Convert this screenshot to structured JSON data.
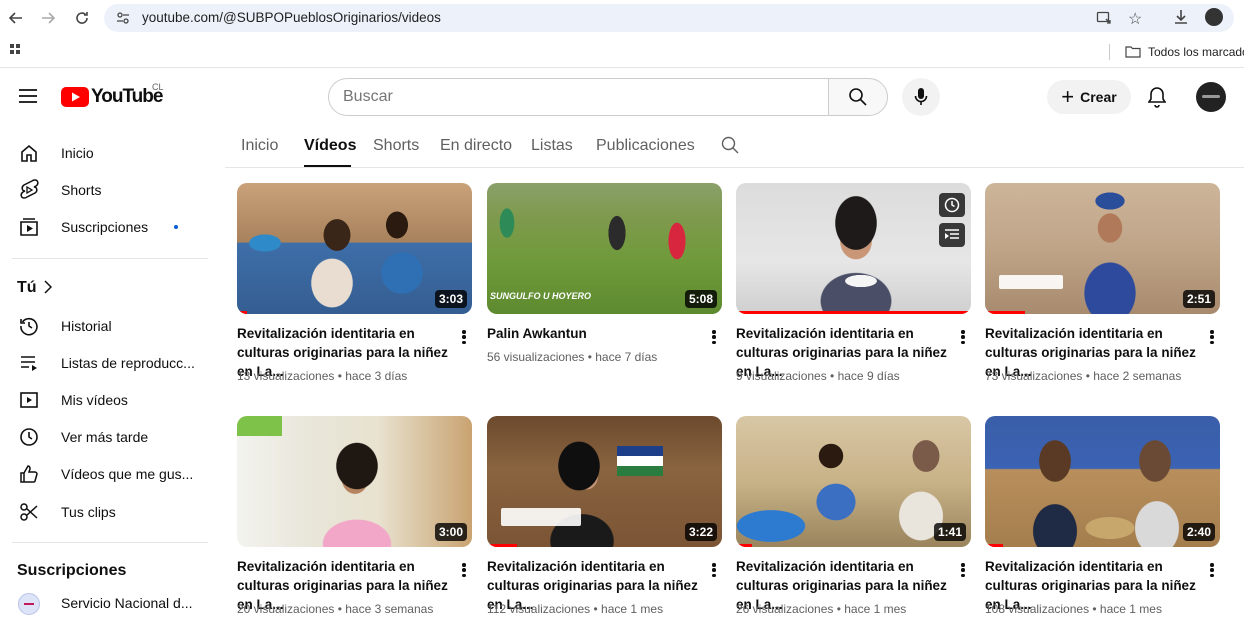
{
  "browser": {
    "url": "youtube.com/@SUBPOPueblosOriginarios/videos",
    "bookmarks_label": "Todos los marcadores"
  },
  "header": {
    "logo_text": "YouTube",
    "region": "CL",
    "search_placeholder": "Buscar",
    "create_label": "Crear"
  },
  "sidebar": {
    "main": [
      {
        "label": "Inicio",
        "icon": "home-icon"
      },
      {
        "label": "Shorts",
        "icon": "shorts-icon"
      },
      {
        "label": "Suscripciones",
        "icon": "subscriptions-icon"
      }
    ],
    "you_heading": "Tú",
    "you_items": [
      {
        "label": "Historial",
        "icon": "history-icon"
      },
      {
        "label": "Listas de reproducc...",
        "icon": "playlists-icon"
      },
      {
        "label": "Mis vídeos",
        "icon": "my-videos-icon"
      },
      {
        "label": "Ver más tarde",
        "icon": "watch-later-icon"
      },
      {
        "label": "Vídeos que me gus...",
        "icon": "liked-icon"
      },
      {
        "label": "Tus clips",
        "icon": "clips-icon"
      }
    ],
    "subs_heading": "Suscripciones",
    "subscriptions": [
      {
        "label": "Servicio Nacional d..."
      }
    ]
  },
  "tabs": [
    "Inicio",
    "Vídeos",
    "Shorts",
    "En directo",
    "Listas",
    "Publicaciones"
  ],
  "videos": [
    {
      "title": "Revitalización identitaria en culturas originarias para la niñez en La...",
      "meta": "13 visualizaciones • hace 3 días",
      "duration": "3:03"
    },
    {
      "title": "Palin Awkantun",
      "meta": "56 visualizaciones • hace 7 días",
      "duration": "5:08"
    },
    {
      "title": "Revitalización identitaria en culturas originarias para la niñez en La...",
      "meta": "9 visualizaciones • hace 9 días",
      "duration": ""
    },
    {
      "title": "Revitalización identitaria en culturas originarias para la niñez en La...",
      "meta": "73 visualizaciones • hace 2 semanas",
      "duration": "2:51"
    },
    {
      "title": "Revitalización identitaria en culturas originarias para la niñez en La...",
      "meta": "20 visualizaciones • hace 3 semanas",
      "duration": "3:00"
    },
    {
      "title": "Revitalización identitaria en culturas originarias para la niñez en La...",
      "meta": "112 visualizaciones • hace 1 mes",
      "duration": "3:22"
    },
    {
      "title": "Revitalización identitaria en culturas originarias para la niñez en La...",
      "meta": "26 visualizaciones • hace 1 mes",
      "duration": "1:41"
    },
    {
      "title": "Revitalización identitaria en culturas originarias para la niñez en La...",
      "meta": "108 visualizaciones • hace 1 mes",
      "duration": "2:40"
    }
  ],
  "thumb_overlays": {
    "v2_caption": "SUNGULFO U HOYERO"
  },
  "colors": {
    "accent": "#ff0000",
    "text": "#0f0f0f",
    "secondary": "#606060"
  }
}
